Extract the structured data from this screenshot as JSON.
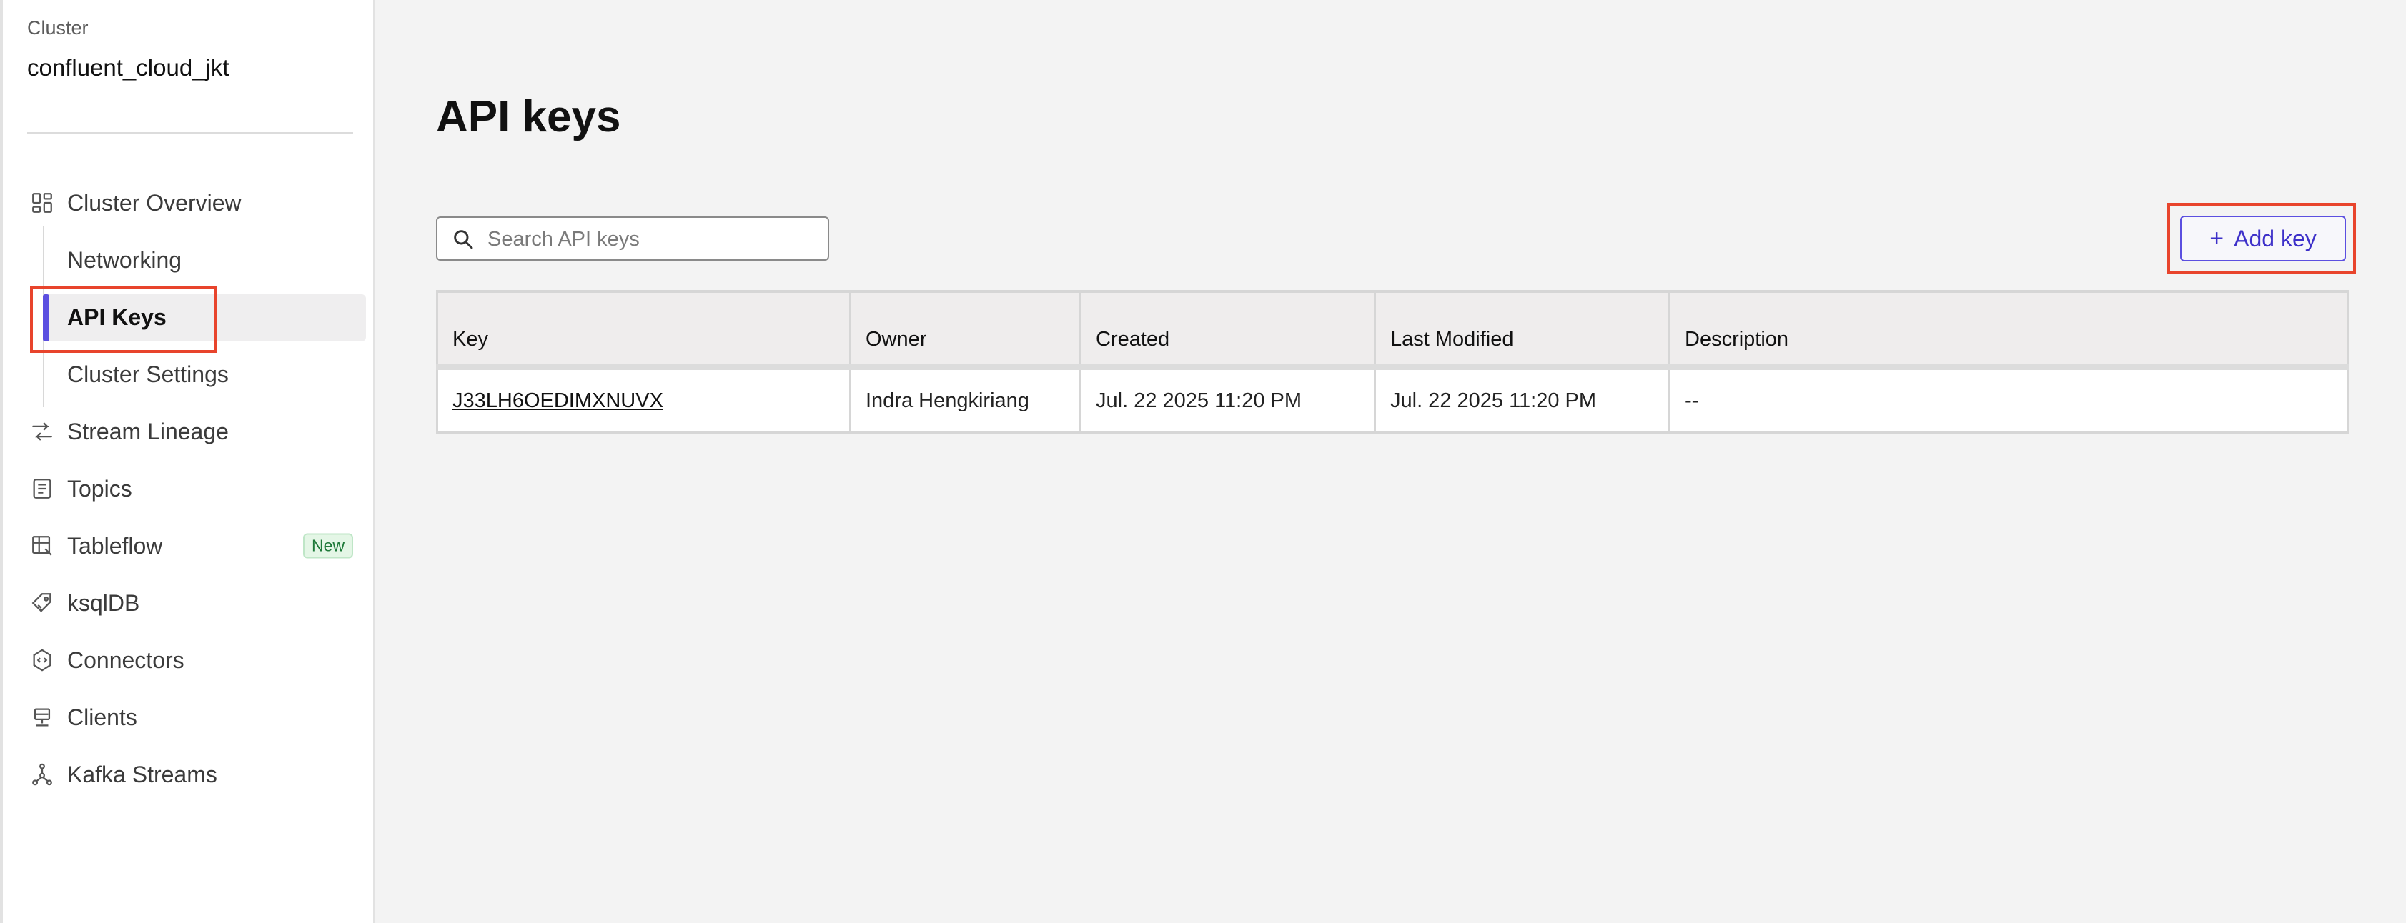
{
  "sidebar": {
    "cluster_label": "Cluster",
    "cluster_name": "confluent_cloud_jkt",
    "items": [
      {
        "label": "Cluster Overview",
        "icon": "dashboard-icon"
      },
      {
        "label": "Networking"
      },
      {
        "label": "API Keys",
        "active": true
      },
      {
        "label": "Cluster Settings"
      },
      {
        "label": "Stream Lineage",
        "icon": "lineage-icon"
      },
      {
        "label": "Topics",
        "icon": "topics-icon"
      },
      {
        "label": "Tableflow",
        "icon": "tableflow-icon",
        "badge": "New"
      },
      {
        "label": "ksqlDB",
        "icon": "ksqldb-icon"
      },
      {
        "label": "Connectors",
        "icon": "connectors-icon"
      },
      {
        "label": "Clients",
        "icon": "clients-icon"
      },
      {
        "label": "Kafka Streams",
        "icon": "kafka-streams-icon"
      }
    ]
  },
  "main": {
    "title": "API keys",
    "search": {
      "placeholder": "Search API keys",
      "value": ""
    },
    "add_button": {
      "plus": "+",
      "label": "Add key"
    },
    "table": {
      "columns": [
        "Key",
        "Owner",
        "Created",
        "Last Modified",
        "Description"
      ],
      "rows": [
        {
          "key": "J33LH6OEDIMXNUVX",
          "owner": "Indra Hengkiriang",
          "created": "Jul. 22 2025 11:20 PM",
          "last_modified": "Jul. 22 2025 11:20 PM",
          "description": "--"
        }
      ]
    }
  },
  "colors": {
    "accent": "#5b4fe0",
    "highlight": "#e8442c",
    "badge_bg": "#e4f6e6",
    "badge_text": "#1f7a3a"
  }
}
